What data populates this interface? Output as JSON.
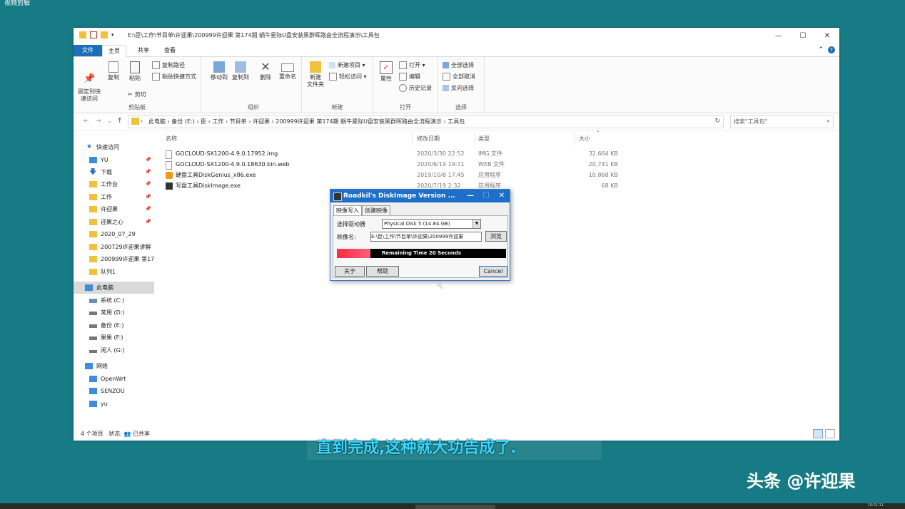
{
  "top_label": "视频剪辑",
  "window": {
    "title_path": "E:\\臣\\工作\\节目单\\许迎果\\200999许迎果 第174期 蜗牛星际U盘安装黑群晖路由全流程演示\\工具包",
    "minimize": "—",
    "maximize": "☐",
    "close": "✕"
  },
  "tabs": {
    "file": "文件",
    "home": "主页",
    "share": "共享",
    "view": "查看"
  },
  "ribbon": {
    "pin_label": "固定到快\n速访问",
    "copy_label": "复制",
    "paste_label": "粘贴",
    "copy_path": "复制路径",
    "paste_shortcut": "粘贴快捷方式",
    "cut": "剪切",
    "clipboard_group": "剪贴板",
    "move_to": "移动到",
    "copy_to": "复制到",
    "delete": "删除",
    "rename": "重命名",
    "organize_group": "组织",
    "new_folder": "新建\n文件夹",
    "new_item": "新建项目",
    "easy_access": "轻松访问",
    "new_group": "新建",
    "properties": "属性",
    "open": "打开",
    "edit": "编辑",
    "history": "历史记录",
    "open_group": "打开",
    "select_all": "全部选择",
    "select_none": "全部取消",
    "invert": "反向选择",
    "select_group": "选择"
  },
  "address": {
    "crumbs": "此电脑  ›  备份 (E:)  ›  臣  ›  工作  ›  节目单  ›  许迎果  ›  200999许迎果 第174期 蜗牛星际U盘安装黑群晖路由全流程演示  ›  工具包",
    "search_placeholder": "搜索\"工具包\""
  },
  "sidebar": {
    "items": [
      {
        "label": "快速访问"
      },
      {
        "label": "YU"
      },
      {
        "label": "下载"
      },
      {
        "label": "工作台"
      },
      {
        "label": "工作"
      },
      {
        "label": "许迎果"
      },
      {
        "label": "迎果之心"
      },
      {
        "label": "2020_07_29"
      },
      {
        "label": "200729许迎果讲解"
      },
      {
        "label": "200999许迎果 第17"
      },
      {
        "label": "队列1"
      },
      {
        "label": "此电脑"
      },
      {
        "label": "系统 (C:)"
      },
      {
        "label": "常用 (D:)"
      },
      {
        "label": "备份 (E:)"
      },
      {
        "label": "果果 (F:)"
      },
      {
        "label": "闲人 (G:)"
      },
      {
        "label": "网络"
      },
      {
        "label": "OpenWrt"
      },
      {
        "label": "SENZOU"
      },
      {
        "label": "yu"
      }
    ]
  },
  "columns": {
    "name": "名称",
    "date": "修改日期",
    "type": "类型",
    "size": "大小"
  },
  "files": [
    {
      "name": "GOCLOUD-SX1200-4.9.0.17952.img",
      "date": "2020/3/30 22:52",
      "type": "IMG 文件",
      "size": "32,664 KB"
    },
    {
      "name": "GOCLOUD-SX1200-4.9.0.18630.bin.web",
      "date": "2020/6/19 19:11",
      "type": "WEB 文件",
      "size": "20,741 KB"
    },
    {
      "name": "硬盘工具DiskGenius_x86.exe",
      "date": "2019/10/8 17:45",
      "type": "应用程序",
      "size": "10,868 KB"
    },
    {
      "name": "写盘工具DiskImage.exe",
      "date": "2020/7/19 2:32",
      "type": "应用程序",
      "size": "68 KB"
    }
  ],
  "status": {
    "count": "4 个项目",
    "state": "状态: 👥 已共享"
  },
  "dialog": {
    "title": "Roadkil's DiskImage Version ...",
    "tab_write": "映像写入",
    "tab_create": "创建映像",
    "drive_label": "选择驱动器",
    "drive_value": "Physical Disk 5 (14.84 GB)",
    "image_label": "映像名:",
    "image_value": "E:\\臣\\工作\\节目单\\许迎果\\200999许迎果",
    "browse": "浏览",
    "progress_text": "Remaining Time 20 Seconds",
    "progress": 0.2,
    "about": "关于",
    "help": "帮助",
    "cancel": "Cancel"
  },
  "subtitle": "直到完成,这种就大功告成了.",
  "watermark": "头条 @许迎果",
  "taskbar_clock": "10:01:11"
}
